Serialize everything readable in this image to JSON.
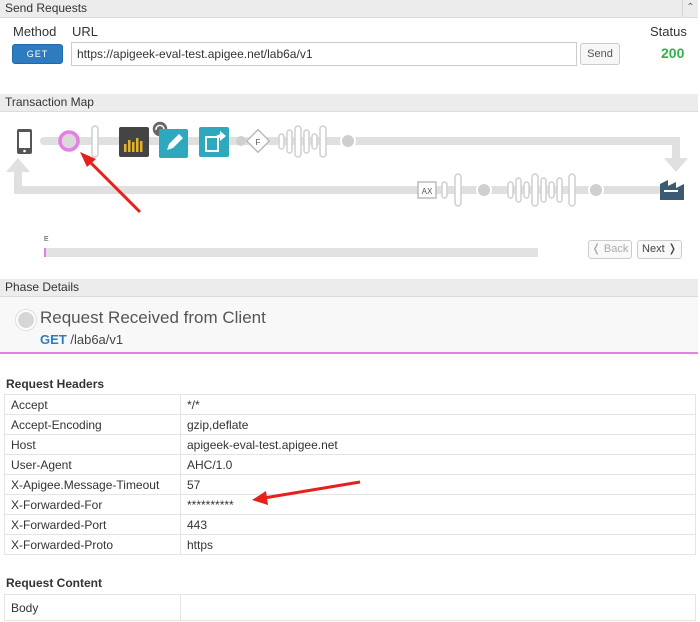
{
  "send_requests": {
    "title": "Send Requests",
    "collapse_glyph": "⌃",
    "method_label": "Method",
    "url_label": "URL",
    "status_label": "Status",
    "method_value": "GET",
    "url_value": "https://apigeek-eval-test.apigee.net/lab6a/v1",
    "send_label": "Send",
    "status_value": "200"
  },
  "transaction_map": {
    "title": "Transaction Map",
    "flow_badge_f": "F",
    "flow_badge_ax": "AX",
    "timeline_start": "E",
    "back_label": "❬ Back",
    "next_label": "Next ❭"
  },
  "phase_details": {
    "title": "Phase Details",
    "phase_title": "Request Received from Client",
    "method": "GET",
    "path": "/lab6a/v1"
  },
  "request_headers": {
    "title": "Request Headers",
    "rows": [
      {
        "key": "Accept",
        "value": "*/*"
      },
      {
        "key": "Accept-Encoding",
        "value": "gzip,deflate"
      },
      {
        "key": "Host",
        "value": "apigeek-eval-test.apigee.net"
      },
      {
        "key": "User-Agent",
        "value": "AHC/1.0"
      },
      {
        "key": "X-Apigee.Message-Timeout",
        "value": "57"
      },
      {
        "key": "X-Forwarded-For",
        "value": "**********"
      },
      {
        "key": "X-Forwarded-Port",
        "value": "443"
      },
      {
        "key": "X-Forwarded-Proto",
        "value": "https"
      }
    ]
  },
  "request_content": {
    "title": "Request Content",
    "rows": [
      {
        "key": "Body",
        "value": ""
      }
    ]
  },
  "colors": {
    "accent_blue": "#2f7bbf",
    "status_green": "#2db34a",
    "phase_pink": "#e67ee6",
    "policy_teal": "#2ea8bd",
    "annotation_red": "#e8201c"
  }
}
